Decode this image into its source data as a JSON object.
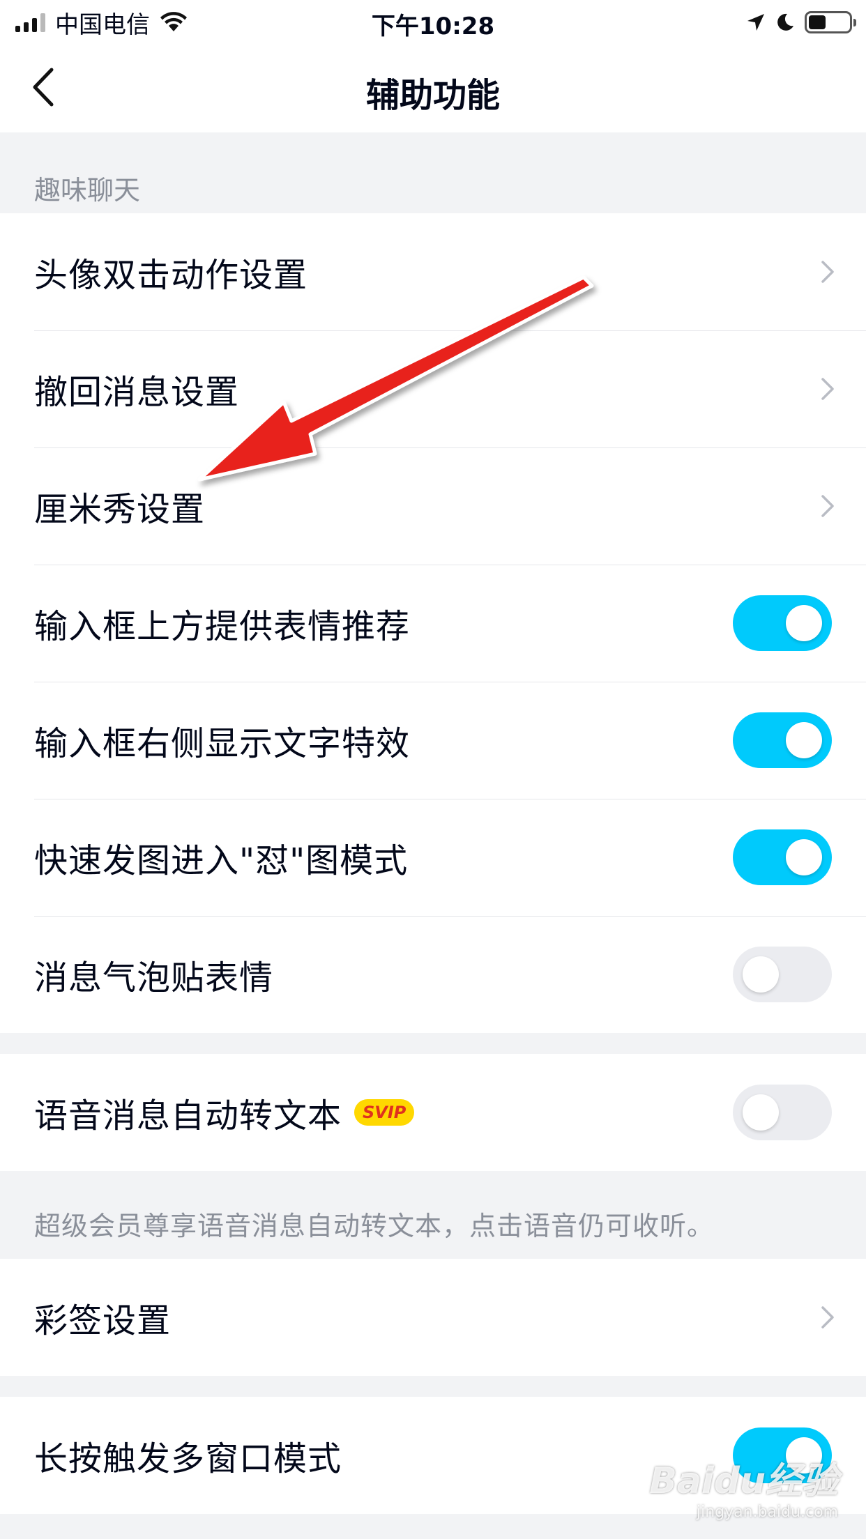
{
  "status_bar": {
    "carrier": "中国电信",
    "time": "下午10:28"
  },
  "nav": {
    "title": "辅助功能"
  },
  "section_fun_chat": {
    "header": "趣味聊天",
    "rows": [
      {
        "label": "头像双击动作设置",
        "control": "chevron"
      },
      {
        "label": "撤回消息设置",
        "control": "chevron"
      },
      {
        "label": "厘米秀设置",
        "control": "chevron"
      },
      {
        "label": "输入框上方提供表情推荐",
        "control": "toggle",
        "on": true
      },
      {
        "label": "输入框右侧显示文字特效",
        "control": "toggle",
        "on": true
      },
      {
        "label": "快速发图进入\"怼\"图模式",
        "control": "toggle",
        "on": true
      },
      {
        "label": "消息气泡贴表情",
        "control": "toggle",
        "on": false
      }
    ]
  },
  "section_voice": {
    "row_label": "语音消息自动转文本",
    "badge": "SVIP",
    "toggle_on": false,
    "note": "超级会员尊享语音消息自动转文本，点击语音仍可收听。"
  },
  "section_tags": {
    "row_label": "彩签设置",
    "control": "chevron"
  },
  "section_multiwindow": {
    "row_label": "长按触发多窗口模式",
    "toggle_on": true
  },
  "watermark": {
    "logo": "Baidu经验",
    "url": "jingyan.baidu.com"
  },
  "colors": {
    "toggle_on": "#00cafc",
    "toggle_off": "#ebecf0",
    "annotation_arrow": "#e8201f",
    "badge_bg": "#ffd800",
    "badge_text": "#e0311e",
    "page_bg": "#f2f3f5"
  }
}
